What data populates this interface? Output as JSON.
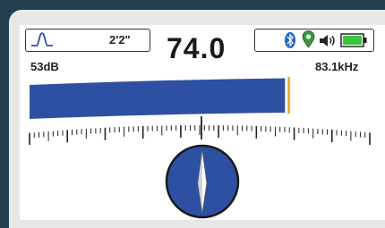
{
  "header": {
    "depth": "2'2\"",
    "reading": "74.0"
  },
  "signal": {
    "gain": "53dB",
    "frequency": "83.1kHz",
    "level": 0.93
  },
  "icons": [
    "peak-mode-icon",
    "bluetooth-icon",
    "gps-pin-icon",
    "speaker-icon",
    "battery-icon",
    "compass-icon"
  ],
  "colors": {
    "bar": "#2e50a3",
    "peak_marker": "#f0a020",
    "bluetooth": "#1f68c4",
    "gps": "#3a9a3a",
    "battery": "#3cc43c",
    "background": "#24404f"
  }
}
